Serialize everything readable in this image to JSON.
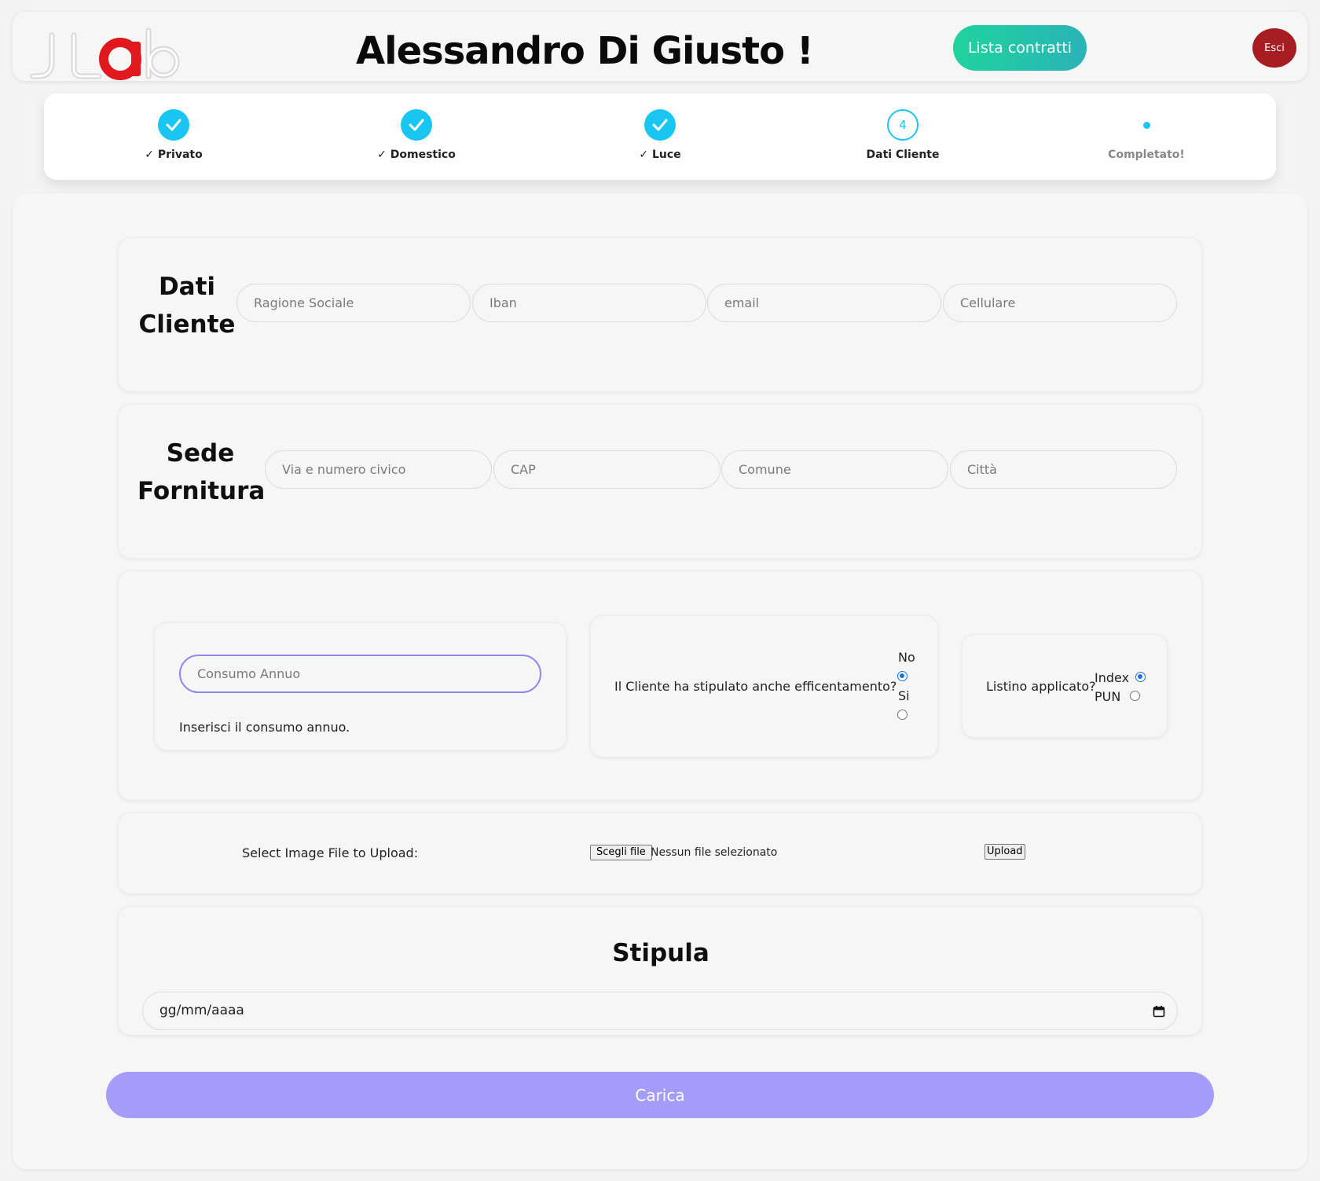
{
  "header": {
    "user_name": "Alessandro Di Giusto !",
    "lista_button": "Lista contratti",
    "esci_button": "Esci"
  },
  "stepper": {
    "steps": [
      {
        "label": "✓ Privato",
        "state": "done"
      },
      {
        "label": "✓ Domestico",
        "state": "done"
      },
      {
        "label": "✓ Luce",
        "state": "done"
      },
      {
        "label": "Dati Cliente",
        "state": "current",
        "number": "4"
      },
      {
        "label": "Completato!",
        "state": "pending"
      }
    ]
  },
  "dati_cliente": {
    "title_line1": "Dati",
    "title_line2": "Cliente",
    "placeholders": [
      "Ragione Sociale",
      "Iban",
      "email",
      "Cellulare"
    ]
  },
  "sede_fornitura": {
    "title_line1": "Sede",
    "title_line2": "Fornitura",
    "placeholders": [
      "Via e numero civico",
      "CAP",
      "Comune",
      "Città"
    ]
  },
  "consumo": {
    "placeholder": "Consumo Annuo",
    "help": "Inserisci il consumo annuo."
  },
  "efficentamento": {
    "question": "Il Cliente ha stipulato anche efficentamento?",
    "options": [
      "No",
      "Si"
    ],
    "selected": "No"
  },
  "listino": {
    "question": "Listino applicato?",
    "options": [
      "Index",
      "PUN"
    ],
    "selected": "Index"
  },
  "upload": {
    "label": "Select Image File to Upload:",
    "choose_button": "Scegli file",
    "no_file": "Nessun file selezionato",
    "upload_button": "Upload"
  },
  "stipula": {
    "title": "Stipula",
    "date_placeholder": "gg/mm/aaaa"
  },
  "submit": {
    "label": "Carica"
  },
  "colors": {
    "accent_cyan": "#19c6f2",
    "lista_gradient_start": "#1fd39c",
    "lista_gradient_end": "#2bb3b8",
    "esci_red": "#a71d22",
    "carica_purple": "#a39cf9",
    "focus_purple": "#8f86ee"
  },
  "icons": [
    "logo",
    "check-icon",
    "calendar-icon"
  ]
}
